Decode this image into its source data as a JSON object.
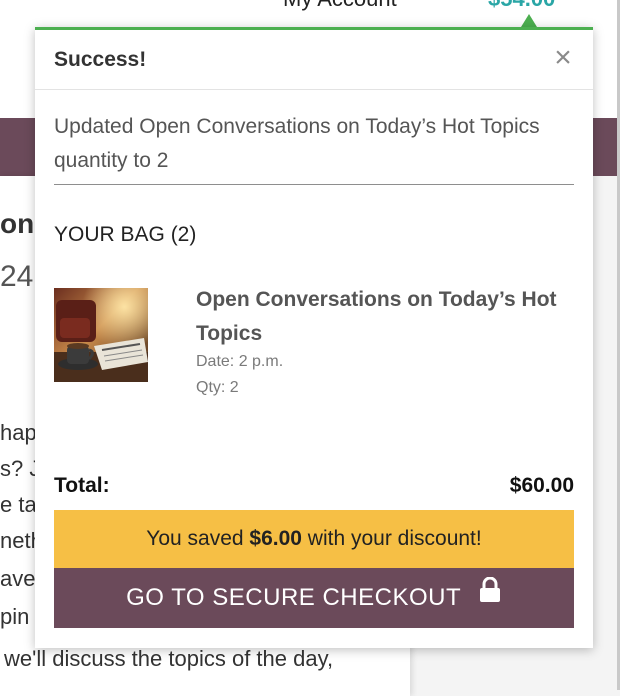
{
  "background": {
    "account_label": "My Account",
    "cart_total": "$54.00",
    "text_lines": [
      "ons",
      "24",
      "hap",
      "s? Jo",
      "e ta",
      "neth",
      "ave",
      "pin",
      "we'll discuss the topics of the day,"
    ]
  },
  "popup": {
    "title": "Success!",
    "close_symbol": "×",
    "message": "Updated Open Conversations on Today’s Hot Topics quantity to 2",
    "bag_title": "YOUR BAG (2)",
    "item": {
      "name": "Open Conversations on Today’s Hot Topics",
      "date": "Date: 2 p.m.",
      "qty": "Qty: 2",
      "thumb_alt": "coffee cup and newspaper"
    },
    "total_label": "Total:",
    "total_value": "$60.00",
    "saved_prefix": "You saved ",
    "saved_amount": "$6.00",
    "saved_suffix": " with your discount!",
    "checkout_label": "GO TO SECURE CHECKOUT",
    "checkout_icon": "lock-icon"
  },
  "colors": {
    "success_accent": "#4caf50",
    "brand_purple": "#6b4a5a",
    "discount_yellow": "#f6bf45",
    "cart_teal": "#2aa6a6"
  }
}
